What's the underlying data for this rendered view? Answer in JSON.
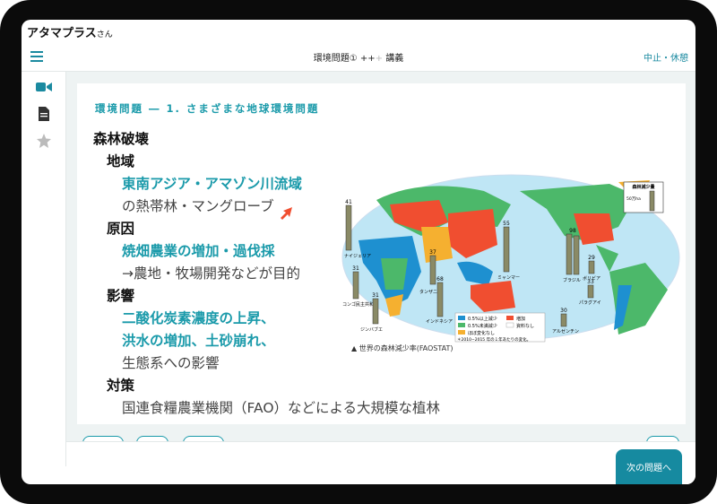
{
  "header": {
    "user_name": "アタマプラス",
    "user_suffix": "さん"
  },
  "nav": {
    "title_main": "環境問題① ++",
    "title_dim": "+",
    "title_suffix": " 講義",
    "quit": "中止・休憩"
  },
  "lesson": {
    "title": "環境問題 ― 1. さまざまな地球環境問題",
    "lines": [
      {
        "text": "森林破壊",
        "style": "h"
      },
      {
        "text": "地域",
        "style": "h"
      },
      {
        "text": "東南アジア・アマゾン川流域",
        "style": "t"
      },
      {
        "text": "の熱帯林・マングローブ",
        "style": "g"
      },
      {
        "text": "原因",
        "style": "h"
      },
      {
        "text": "焼畑農業の増加・過伐採",
        "style": "t"
      },
      {
        "text": "→農地・牧場開発などが目的",
        "style": "g"
      },
      {
        "text": "影響",
        "style": "h"
      },
      {
        "text": "二酸化炭素濃度の上昇、",
        "style": "t"
      },
      {
        "text": "洪水の増加、土砂崩れ、",
        "style": "t"
      },
      {
        "text": "生態系への影響",
        "style": "g"
      },
      {
        "text": "対策",
        "style": "h"
      },
      {
        "text": "国連食糧農業機関（FAO）などによる大規模な植林",
        "style": "g"
      }
    ]
  },
  "map": {
    "legend_title": "森林減少量",
    "legend_unit": "50万ha",
    "legend": [
      {
        "label": "0.5%以上減少",
        "color": "#1e90d0"
      },
      {
        "label": "0.5%未満減少",
        "color": "#4cb86a"
      },
      {
        "label": "ほぼ変化なし",
        "color": "#f5b030"
      },
      {
        "label": "増加",
        "color": "#f04e30"
      },
      {
        "label": "資料なし",
        "color": "#ffffff"
      }
    ],
    "note": "＊2010−2015 年の１年あたりの変化。",
    "caption": "▲ 世界の森林減少率(FAOSTAT)",
    "countries": [
      {
        "name": "ナイジェリア",
        "value": "41"
      },
      {
        "name": "コンゴ民主共和国",
        "value": "31"
      },
      {
        "name": "ジンバブエ",
        "value": "31"
      },
      {
        "name": "タンザニア",
        "value": "37"
      },
      {
        "name": "インドネシア",
        "value": "68"
      },
      {
        "name": "ミャンマー",
        "value": "55"
      },
      {
        "name": "ブラジル",
        "value": "98"
      },
      {
        "name": "ボリビア",
        "value": "29"
      },
      {
        "name": "パラグアイ",
        "value": "33"
      },
      {
        "name": "アルゼンチン",
        "value": "30"
      }
    ]
  },
  "footer": {
    "next": "次の問題へ"
  }
}
